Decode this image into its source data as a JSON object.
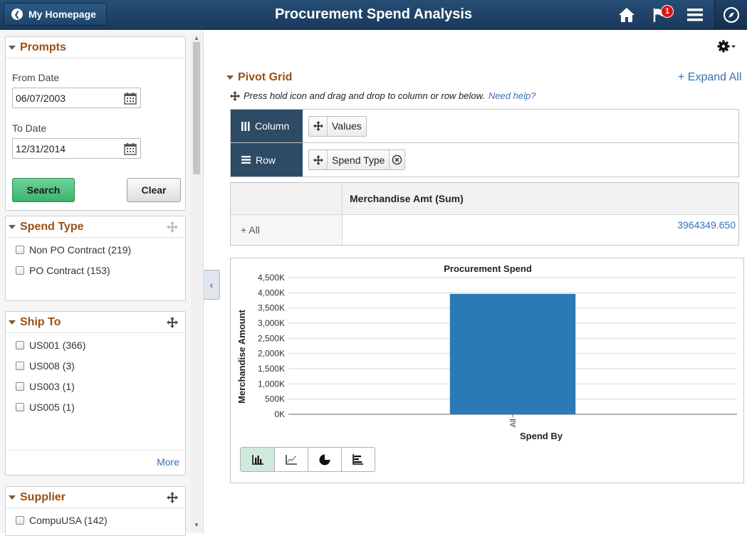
{
  "header": {
    "back_label": "My Homepage",
    "title": "Procurement Spend Analysis",
    "notification_count": "1",
    "icons": [
      "home-icon",
      "flag-icon",
      "hamburger-menu-icon",
      "nav-bar-compass-icon"
    ]
  },
  "prompts": {
    "title": "Prompts",
    "from_date_label": "From Date",
    "from_date_value": "06/07/2003",
    "to_date_label": "To Date",
    "to_date_value": "12/31/2014",
    "search_label": "Search",
    "clear_label": "Clear"
  },
  "facets": {
    "spend_type": {
      "title": "Spend Type",
      "items": [
        {
          "label": "Non PO Contract (219)"
        },
        {
          "label": "PO Contract (153)"
        }
      ]
    },
    "ship_to": {
      "title": "Ship To",
      "items": [
        {
          "label": "US001 (366)"
        },
        {
          "label": "US008 (3)"
        },
        {
          "label": "US003 (1)"
        },
        {
          "label": "US005 (1)"
        }
      ],
      "more_label": "More"
    },
    "supplier": {
      "title": "Supplier",
      "items": [
        {
          "label": "CompuUSA (142)"
        }
      ]
    }
  },
  "pivot": {
    "title": "Pivot Grid",
    "expand_all": "+ Expand All",
    "hint": "Press hold icon and drag and drop to column or row below.",
    "need_help": "Need help?",
    "column_label": "Column",
    "row_label": "Row",
    "column_chip": "Values",
    "row_chip": "Spend Type"
  },
  "grid": {
    "header": "Merchandise Amt (Sum)",
    "row_label": "+ All",
    "row_value": "3964349.650"
  },
  "chart_data": {
    "type": "bar",
    "title": "Procurement Spend",
    "xlabel": "Spend By",
    "ylabel": "Merchandise Amount",
    "categories": [
      "All"
    ],
    "values": [
      3964349.65
    ],
    "ylim": [
      0,
      4500000
    ],
    "yticks": [
      0,
      500000,
      1000000,
      1500000,
      2000000,
      2500000,
      3000000,
      3500000,
      4000000,
      4500000
    ],
    "ytick_labels": [
      "0K",
      "500K",
      "1,000K",
      "1,500K",
      "2,000K",
      "2,500K",
      "3,000K",
      "3,500K",
      "4,000K",
      "4,500K"
    ],
    "grid": true,
    "bar_color": "#2a7ab6"
  },
  "chart_tools": [
    "bar-chart-icon",
    "line-chart-icon",
    "pie-chart-icon",
    "horizontal-bar-chart-icon"
  ]
}
